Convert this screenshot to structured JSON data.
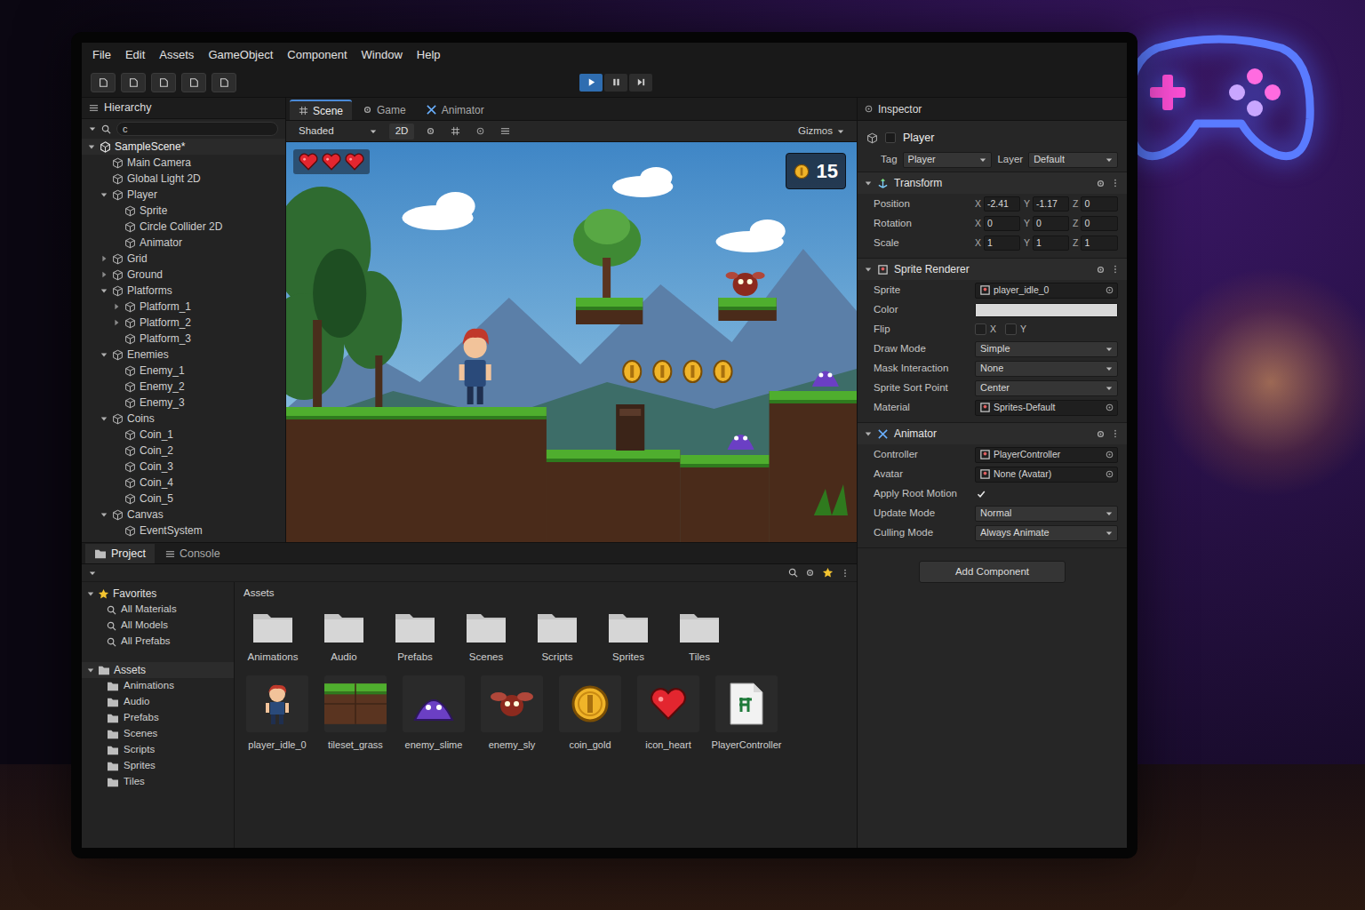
{
  "menu": [
    "File",
    "Edit",
    "Assets",
    "GameObject",
    "Component",
    "Window",
    "Help"
  ],
  "toolbar": {
    "playback": [
      {
        "kind": "play",
        "selected": true
      },
      {
        "kind": "pause",
        "selected": false
      },
      {
        "kind": "step",
        "selected": false
      }
    ]
  },
  "hierarchy": {
    "title": "Hierarchy",
    "search": "c",
    "items": [
      {
        "label": "SampleScene*",
        "depth": 0,
        "kind": "scene",
        "expanded": true
      },
      {
        "label": "Main Camera",
        "depth": 1,
        "kind": "item"
      },
      {
        "label": "Global Light 2D",
        "depth": 1,
        "kind": "item"
      },
      {
        "label": "Player",
        "depth": 1,
        "kind": "group",
        "expanded": true
      },
      {
        "label": "Sprite",
        "depth": 2,
        "kind": "item"
      },
      {
        "label": "Circle Collider 2D",
        "depth": 2,
        "kind": "item"
      },
      {
        "label": "Animator",
        "depth": 2,
        "kind": "item"
      },
      {
        "label": "Grid",
        "depth": 1,
        "kind": "group",
        "expanded": false
      },
      {
        "label": "Ground",
        "depth": 1,
        "kind": "group",
        "expanded": false
      },
      {
        "label": "Platforms",
        "depth": 1,
        "kind": "group",
        "expanded": true
      },
      {
        "label": "Platform_1",
        "depth": 2,
        "kind": "group",
        "expanded": false
      },
      {
        "label": "Platform_2",
        "depth": 2,
        "kind": "group",
        "expanded": false
      },
      {
        "label": "Platform_3",
        "depth": 2,
        "kind": "item"
      },
      {
        "label": "Enemies",
        "depth": 1,
        "kind": "group",
        "expanded": true
      },
      {
        "label": "Enemy_1",
        "depth": 2,
        "kind": "item"
      },
      {
        "label": "Enemy_2",
        "depth": 2,
        "kind": "item"
      },
      {
        "label": "Enemy_3",
        "depth": 2,
        "kind": "item"
      },
      {
        "label": "Coins",
        "depth": 1,
        "kind": "group",
        "expanded": true
      },
      {
        "label": "Coin_1",
        "depth": 2,
        "kind": "item"
      },
      {
        "label": "Coin_2",
        "depth": 2,
        "kind": "item"
      },
      {
        "label": "Coin_3",
        "depth": 2,
        "kind": "item"
      },
      {
        "label": "Coin_4",
        "depth": 2,
        "kind": "item"
      },
      {
        "label": "Coin_5",
        "depth": 2,
        "kind": "item"
      },
      {
        "label": "Canvas",
        "depth": 1,
        "kind": "group",
        "expanded": true
      },
      {
        "label": "EventSystem",
        "depth": 2,
        "kind": "item"
      }
    ]
  },
  "scene_view": {
    "tabs": [
      {
        "label": "Scene",
        "selected": true
      },
      {
        "label": "Game",
        "selected": false
      },
      {
        "label": "Animator",
        "selected": false
      }
    ],
    "shading": "Shaded",
    "mode_2d": "2D",
    "gizmos": "Gizmos",
    "hud": {
      "hearts": 3,
      "coins": "15"
    }
  },
  "inspector": {
    "title": "Inspector",
    "object_name": "Player",
    "tag_label": "Tag",
    "tag": "Player",
    "layer_label": "Layer",
    "layer": "Default",
    "components": [
      {
        "name": "Transform",
        "kind": "transform",
        "rows": [
          {
            "label": "Position",
            "kind": "vector",
            "values": [
              {
                "axis": "X",
                "value": "-2.41"
              },
              {
                "axis": "Y",
                "value": "-1.17"
              },
              {
                "axis": "Z",
                "value": "0"
              }
            ]
          },
          {
            "label": "Rotation",
            "kind": "vector",
            "values": [
              {
                "axis": "X",
                "value": "0"
              },
              {
                "axis": "Y",
                "value": "0"
              },
              {
                "axis": "Z",
                "value": "0"
              }
            ]
          },
          {
            "label": "Scale",
            "kind": "vector",
            "values": [
              {
                "axis": "X",
                "value": "1"
              },
              {
                "axis": "Y",
                "value": "1"
              },
              {
                "axis": "Z",
                "value": "1"
              }
            ]
          }
        ]
      },
      {
        "name": "Sprite Renderer",
        "kind": "sprite",
        "rows": [
          {
            "label": "Sprite",
            "kind": "object",
            "value": "player_idle_0"
          },
          {
            "label": "Color",
            "kind": "color",
            "color": "#d9d9d9"
          },
          {
            "label": "Flip",
            "kind": "flip",
            "options": [
              {
                "axis": "X",
                "checked": false
              },
              {
                "axis": "Y",
                "checked": false
              }
            ]
          },
          {
            "label": "Draw Mode",
            "kind": "dropdown",
            "value": "Simple"
          },
          {
            "label": "Mask Interaction",
            "kind": "dropdown",
            "value": "None"
          },
          {
            "label": "Sprite Sort Point",
            "kind": "dropdown",
            "value": "Center"
          },
          {
            "label": "Material",
            "kind": "object",
            "value": "Sprites-Default"
          }
        ]
      },
      {
        "name": "Animator",
        "kind": "animator",
        "rows": [
          {
            "label": "Controller",
            "kind": "object",
            "value": "PlayerController"
          },
          {
            "label": "Avatar",
            "kind": "object",
            "value": "None (Avatar)"
          },
          {
            "label": "Apply Root Motion",
            "kind": "checkbox",
            "checked": true
          },
          {
            "label": "Update Mode",
            "kind": "dropdown",
            "value": "Normal"
          },
          {
            "label": "Culling Mode",
            "kind": "dropdown",
            "value": "Always Animate"
          }
        ]
      }
    ],
    "add_component": "Add Component"
  },
  "project": {
    "tabs": [
      {
        "label": "Project",
        "selected": true
      },
      {
        "label": "Console",
        "selected": false
      }
    ],
    "favorites": {
      "title": "Favorites",
      "items": [
        "All Materials",
        "All Models",
        "All Prefabs"
      ]
    },
    "tree": {
      "title": "Assets",
      "items": [
        "Animations",
        "Audio",
        "Prefabs",
        "Scenes",
        "Scripts",
        "Sprites",
        "Tiles"
      ]
    },
    "breadcrumb": "Assets",
    "folders": [
      "Animations",
      "Audio",
      "Prefabs",
      "Scenes",
      "Scripts",
      "Sprites",
      "Tiles"
    ],
    "files": [
      {
        "label": "player_idle_0",
        "kind": "player"
      },
      {
        "label": "tileset_grass",
        "kind": "tiles"
      },
      {
        "label": "enemy_slime",
        "kind": "slime"
      },
      {
        "label": "enemy_sly",
        "kind": "fly"
      },
      {
        "label": "coin_gold",
        "kind": "coin"
      },
      {
        "label": "icon_heart",
        "kind": "heart"
      },
      {
        "label": "PlayerController",
        "kind": "script"
      }
    ]
  }
}
